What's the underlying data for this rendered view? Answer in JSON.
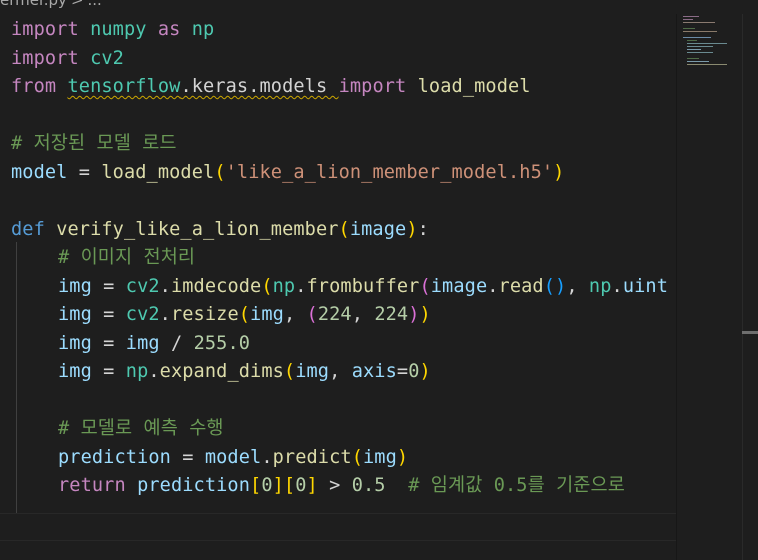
{
  "breadcrumb": {
    "file": "ermer.py",
    "separator": ">",
    "ellipsis": "..."
  },
  "code": {
    "l1": {
      "a": "import",
      "b": " numpy ",
      "c": "as",
      "d": " np"
    },
    "l2": {
      "a": "import",
      "b": " cv2"
    },
    "l3": {
      "a": "from",
      "b": " ",
      "c": "tensorflow",
      "d": ".keras.models ",
      "e": "import",
      "f": " load_model"
    },
    "l5": "# 저장된 모델 로드",
    "l6": {
      "a": "model",
      "b": " = ",
      "c": "load_model",
      "d": "(",
      "e": "'like_a_lion_member_model.h5'",
      "f": ")"
    },
    "l8": {
      "a": "def",
      "b": " ",
      "c": "verify_like_a_lion_member",
      "d": "(",
      "e": "image",
      "f": ")",
      "g": ":"
    },
    "l9": "# 이미지 전처리",
    "l10": {
      "a": "img",
      "b": " = ",
      "c": "cv2",
      "d": ".",
      "e": "imdecode",
      "f": "(",
      "g": "np",
      "h": ".",
      "i": "frombuffer",
      "j": "(",
      "k": "image",
      "l": ".",
      "m": "read",
      "n": "()",
      "o": ", ",
      "p": "np",
      "q": ".",
      "r": "uint"
    },
    "l11": {
      "a": "img",
      "b": " = ",
      "c": "cv2",
      "d": ".",
      "e": "resize",
      "f": "(",
      "g": "img",
      "h": ", ",
      "i": "(",
      "j": "224",
      "k": ", ",
      "l": "224",
      "m": ")",
      "n": ")"
    },
    "l12": {
      "a": "img",
      "b": " = ",
      "c": "img",
      "d": " / ",
      "e": "255.0"
    },
    "l13": {
      "a": "img",
      "b": " = ",
      "c": "np",
      "d": ".",
      "e": "expand_dims",
      "f": "(",
      "g": "img",
      "h": ", ",
      "i": "axis",
      "j": "=",
      "k": "0",
      "l": ")"
    },
    "l15": "# 모델로 예측 수행",
    "l16": {
      "a": "prediction",
      "b": " = ",
      "c": "model",
      "d": ".",
      "e": "predict",
      "f": "(",
      "g": "img",
      "h": ")"
    },
    "l17": {
      "a": "return",
      "b": " ",
      "c": "prediction",
      "d": "[",
      "e": "0",
      "f": "]",
      "g": "[",
      "h": "0",
      "i": "]",
      "j": " > ",
      "k": "0.5",
      "l": "  ",
      "m": "# 임계값 0.5를 기준으로"
    }
  },
  "colors": {
    "background": "#1e1e1e",
    "keyword": "#c586c0",
    "storage": "#569cd6",
    "function": "#dcdcaa",
    "variable": "#9cdcfe",
    "module": "#4ec9b0",
    "string": "#ce9178",
    "number": "#b5cea8",
    "comment": "#6a9955"
  }
}
